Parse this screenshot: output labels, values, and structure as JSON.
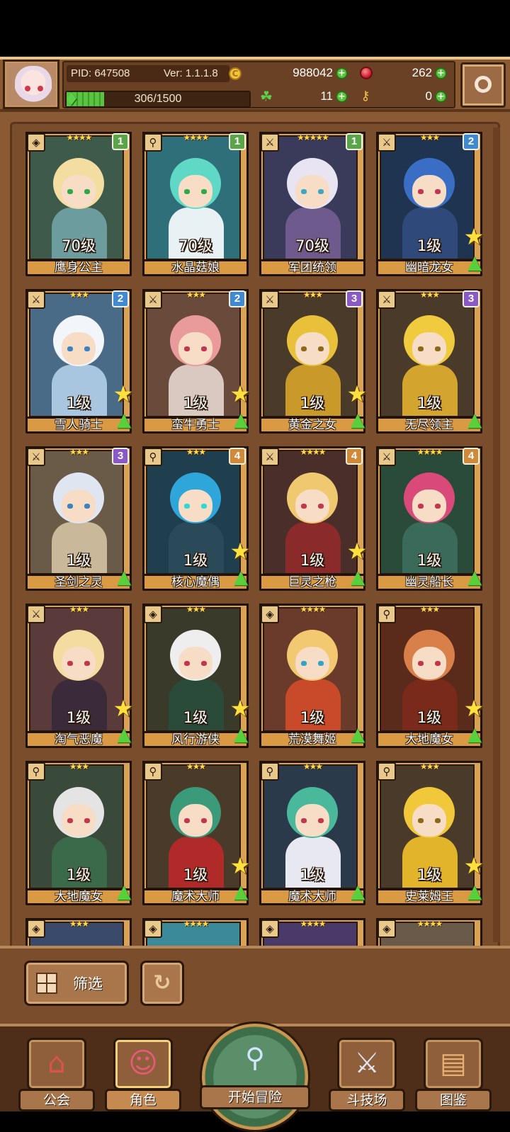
{
  "header": {
    "pid": "PID: 647508",
    "version": "Ver: 1.1.1.8",
    "exp": "306/1500",
    "exp_fraction": 0.204,
    "gold": "988042",
    "gems": "262",
    "clover": "11",
    "keys": "0"
  },
  "cards": [
    {
      "name": "鹰身公主",
      "level": "70级",
      "stars": "★★★★",
      "tier": "1",
      "tier_color": "#5aa54a",
      "type_icon": "shield-icon",
      "bg": "#3d5a4b",
      "hair": "#f4dda0",
      "body": "#6d9c9e",
      "eye": "#2fa84a",
      "star_badge": false,
      "up_badge": false
    },
    {
      "name": "水晶菇娘",
      "level": "70级",
      "stars": "★★★★",
      "tier": "1",
      "tier_color": "#5aa54a",
      "type_icon": "staff-icon",
      "bg": "#2f6f7a",
      "hair": "#5fd9c6",
      "body": "#e8f1f4",
      "eye": "#2fa84a",
      "star_badge": false,
      "up_badge": false
    },
    {
      "name": "军团统领",
      "level": "70级",
      "stars": "★★★★★",
      "tier": "1",
      "tier_color": "#5aa54a",
      "type_icon": "sword-icon",
      "bg": "#3a3a5a",
      "hair": "#e8e4f2",
      "body": "#6e5a8c",
      "eye": "#3aa7c4",
      "star_badge": false,
      "up_badge": false
    },
    {
      "name": "幽暗龙女",
      "level": "1级",
      "stars": "★★★",
      "tier": "2",
      "tier_color": "#3f8ad1",
      "type_icon": "sword-icon",
      "bg": "#1f3450",
      "hair": "#3a6ec4",
      "body": "#2f4a7a",
      "eye": "#c2374d",
      "star_badge": true,
      "up_badge": true
    },
    {
      "name": "雪人骑士",
      "level": "1级",
      "stars": "★★★",
      "tier": "2",
      "tier_color": "#3f8ad1",
      "type_icon": "sword-icon",
      "bg": "#4a6b88",
      "hair": "#f2f6fb",
      "body": "#a9c6e0",
      "eye": "#3a84c4",
      "star_badge": true,
      "up_badge": true
    },
    {
      "name": "蛮牛勇士",
      "level": "1级",
      "stars": "★★★",
      "tier": "2",
      "tier_color": "#3f8ad1",
      "type_icon": "sword-icon",
      "bg": "#6a4a3a",
      "hair": "#e99a9a",
      "body": "#d9c9c0",
      "eye": "#c2374d",
      "star_badge": true,
      "up_badge": true
    },
    {
      "name": "黄金之女",
      "level": "1级",
      "stars": "★★★",
      "tier": "3",
      "tier_color": "#8a5ac4",
      "type_icon": "sword-icon",
      "bg": "#4a3a2a",
      "hair": "#e8c03a",
      "body": "#c99a2a",
      "eye": "#8a6a1a",
      "star_badge": true,
      "up_badge": true
    },
    {
      "name": "无尽领主",
      "level": "1级",
      "stars": "★★★",
      "tier": "3",
      "tier_color": "#8a5ac4",
      "type_icon": "sword-icon",
      "bg": "#4a3a2a",
      "hair": "#f0cb3e",
      "body": "#d4a52e",
      "eye": "#8a6a1a",
      "star_badge": false,
      "up_badge": true
    },
    {
      "name": "圣剑之灵",
      "level": "1级",
      "stars": "★★★",
      "tier": "3",
      "tier_color": "#8a5ac4",
      "type_icon": "sword-icon",
      "bg": "#6a5a48",
      "hair": "#dfe6f2",
      "body": "#c9b89a",
      "eye": "#3a84c4",
      "star_badge": false,
      "up_badge": true
    },
    {
      "name": "核心魔偶",
      "level": "1级",
      "stars": "★★★",
      "tier": "4",
      "tier_color": "#d08a3a",
      "type_icon": "staff-icon",
      "bg": "#1f3e4e",
      "hair": "#2fa6d9",
      "body": "#2a4a5a",
      "eye": "#2fd9d0",
      "star_badge": true,
      "up_badge": true
    },
    {
      "name": "巨灵之枪",
      "level": "1级",
      "stars": "★★★★",
      "tier": "4",
      "tier_color": "#d08a3a",
      "type_icon": "sword-icon",
      "bg": "#4a2e2a",
      "hair": "#f0c870",
      "body": "#8a2a2a",
      "eye": "#c2374d",
      "star_badge": true,
      "up_badge": true
    },
    {
      "name": "幽灵船长",
      "level": "1级",
      "stars": "★★★★",
      "tier": "4",
      "tier_color": "#d08a3a",
      "type_icon": "sword-icon",
      "bg": "#2a4a3a",
      "hair": "#d94a7a",
      "body": "#3a6a5a",
      "eye": "#c2374d",
      "star_badge": false,
      "up_badge": true
    },
    {
      "name": "淘气恶魔",
      "level": "1级",
      "stars": "★★★",
      "tier": "",
      "tier_color": "",
      "type_icon": "sword-icon",
      "bg": "#5a3a3a",
      "hair": "#f4dca0",
      "body": "#3a2a3a",
      "eye": "#c2374d",
      "star_badge": true,
      "up_badge": true
    },
    {
      "name": "风行游侠",
      "level": "1级",
      "stars": "★★★",
      "tier": "",
      "tier_color": "",
      "type_icon": "shield-icon",
      "bg": "#3a3a2a",
      "hair": "#eeeeee",
      "body": "#2a4a3a",
      "eye": "#c2374d",
      "star_badge": true,
      "up_badge": true
    },
    {
      "name": "荒漠舞姬",
      "level": "1级",
      "stars": "★★★★",
      "tier": "",
      "tier_color": "",
      "type_icon": "shield-icon",
      "bg": "#6a3a2a",
      "hair": "#f2c870",
      "body": "#c94a2a",
      "eye": "#2fa6c4",
      "star_badge": false,
      "up_badge": true
    },
    {
      "name": "大地魔女",
      "level": "1级",
      "stars": "★★★",
      "tier": "",
      "tier_color": "",
      "type_icon": "staff-icon",
      "bg": "#5a2a1a",
      "hair": "#d9804a",
      "body": "#7a2a1a",
      "eye": "#c2374d",
      "star_badge": true,
      "up_badge": true
    },
    {
      "name": "大地魔女",
      "level": "1级",
      "stars": "★★★",
      "tier": "",
      "tier_color": "",
      "type_icon": "staff-icon",
      "bg": "#3a4a3a",
      "hair": "#e4e4e4",
      "body": "#3a6a4a",
      "eye": "#c2374d",
      "star_badge": false,
      "up_badge": true
    },
    {
      "name": "魔术大师",
      "level": "1级",
      "stars": "★★★",
      "tier": "",
      "tier_color": "",
      "type_icon": "staff-icon",
      "bg": "#4a3a2a",
      "hair": "#3a9a7a",
      "body": "#b02a2a",
      "eye": "#c2374d",
      "star_badge": true,
      "up_badge": true
    },
    {
      "name": "魔术大师",
      "level": "1级",
      "stars": "★★★",
      "tier": "",
      "tier_color": "",
      "type_icon": "staff-icon",
      "bg": "#2a3a4a",
      "hair": "#4ab89a",
      "body": "#e8e8f0",
      "eye": "#c2374d",
      "star_badge": false,
      "up_badge": true
    },
    {
      "name": "史莱姆王",
      "level": "1级",
      "stars": "★★★",
      "tier": "",
      "tier_color": "",
      "type_icon": "staff-icon",
      "bg": "#4a3a2a",
      "hair": "#f0c83a",
      "body": "#e2b42a",
      "eye": "#8a6a1a",
      "star_badge": true,
      "up_badge": true
    }
  ],
  "partial_cards": [
    {
      "stars": "★★★",
      "bg": "#3a4a6a",
      "type_icon": "shield-icon"
    },
    {
      "stars": "★★★★",
      "bg": "#3a8a9a",
      "type_icon": "shield-icon"
    },
    {
      "stars": "★★★★",
      "bg": "#4a3a6a",
      "type_icon": "shield-icon"
    },
    {
      "stars": "★★★★",
      "bg": "#6a5a4a",
      "type_icon": "shield-icon"
    }
  ],
  "controls": {
    "filter_label": "筛选"
  },
  "nav": {
    "guild": "公会",
    "character": "角色",
    "adventure": "开始冒险",
    "arena": "斗技场",
    "codex": "图鉴"
  }
}
